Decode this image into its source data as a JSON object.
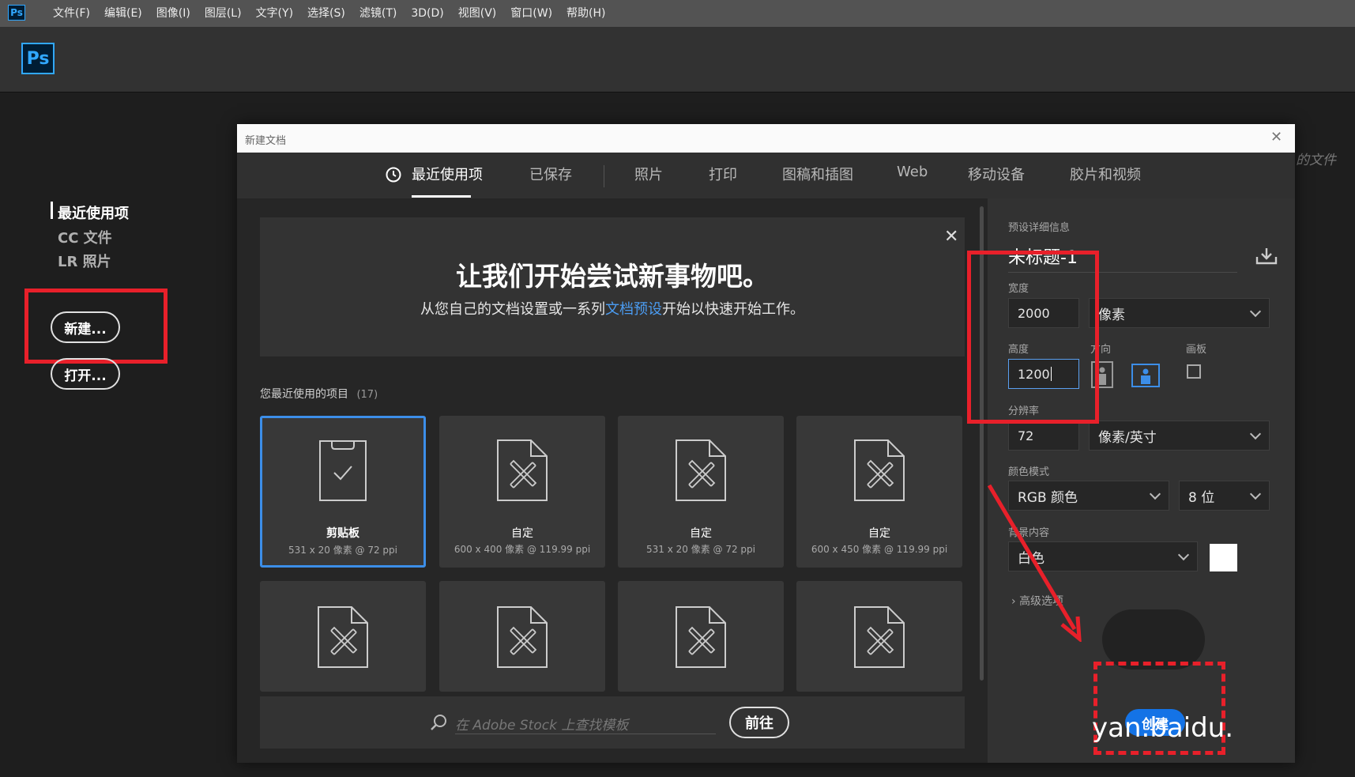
{
  "app": {
    "logo_small": "Ps",
    "logo_large": "Ps"
  },
  "menu": [
    "文件(F)",
    "编辑(E)",
    "图像(I)",
    "图层(L)",
    "文字(Y)",
    "选择(S)",
    "滤镜(T)",
    "3D(D)",
    "视图(V)",
    "窗口(W)",
    "帮助(H)"
  ],
  "left_nav": {
    "items": [
      "最近使用项",
      "CC 文件",
      "LR 照片"
    ],
    "new_button": "新建...",
    "open_button": "打开..."
  },
  "background_text": "的文件",
  "dialog": {
    "title": "新建文档",
    "tabs": [
      "最近使用项",
      "已保存",
      "照片",
      "打印",
      "图稿和插图",
      "Web",
      "移动设备",
      "胶片和视频"
    ],
    "banner": {
      "heading": "让我们开始尝试新事物吧。",
      "sub_before": "从您自己的文档设置或一系列",
      "sub_link": "文档预设",
      "sub_after": "开始以快速开始工作。"
    },
    "recent": {
      "label": "您最近使用的项目",
      "count": "(17)"
    },
    "presets": [
      {
        "name": "剪贴板",
        "size": "531 x 20 像素 @ 72 ppi",
        "icon": "clipboard-check-icon"
      },
      {
        "name": "自定",
        "size": "600 x 400 像素 @ 119.99 ppi",
        "icon": "document-ruler-icon"
      },
      {
        "name": "自定",
        "size": "531 x 20 像素 @ 72 ppi",
        "icon": "document-ruler-icon"
      },
      {
        "name": "自定",
        "size": "600 x 450 像素 @ 119.99 ppi",
        "icon": "document-ruler-icon"
      }
    ],
    "stock": {
      "placeholder": "在 Adobe Stock 上查找模板",
      "go": "前往"
    },
    "details": {
      "header": "预设详细信息",
      "doc_name": "未标题-1",
      "width_label": "宽度",
      "width": "2000",
      "width_unit": "像素",
      "height_label": "高度",
      "height": "1200",
      "orientation_label": "方向",
      "artboard_label": "画板",
      "resolution_label": "分辨率",
      "resolution": "72",
      "resolution_unit": "像素/英寸",
      "color_mode_label": "颜色模式",
      "color_mode": "RGB 颜色",
      "bit_depth": "8 位",
      "bg_label": "背景内容",
      "bg": "白色",
      "bg_swatch": "#ffffff",
      "advanced": "高级选项",
      "create": "创建"
    }
  },
  "watermark": "yan.baidu.",
  "colors": {
    "accent": "#31a8ff",
    "highlight": "#e8202a",
    "primary_button": "#1473e6"
  }
}
